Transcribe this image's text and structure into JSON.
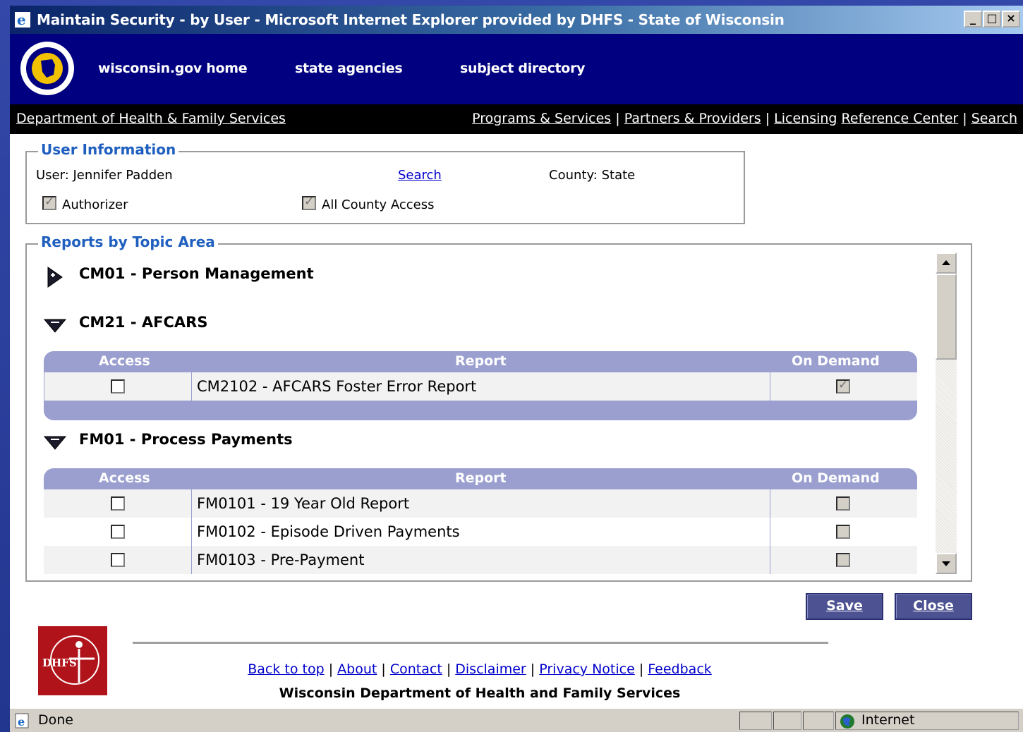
{
  "window": {
    "title": "Maintain Security - by User - Microsoft Internet Explorer provided by DHFS - State of Wisconsin",
    "controls": [
      "minimize",
      "maximize",
      "close"
    ]
  },
  "banner": {
    "links": [
      "wisconsin.gov home",
      "state agencies",
      "subject directory"
    ]
  },
  "dept_bar": {
    "name": "Department of Health & Family Services",
    "links": [
      "Programs & Services",
      "Partners & Providers",
      "Licensing",
      "Reference Center",
      "Search"
    ]
  },
  "user_info": {
    "legend": "User Information",
    "user_text": "User: Jennifer   Padden",
    "search_link": "Search",
    "county_text": "County: State",
    "authorizer_label": "Authorizer",
    "authorizer_checked": true,
    "all_county_label": "All County Access",
    "all_county_checked": true
  },
  "reports": {
    "legend": "Reports by Topic Area",
    "column_headers": {
      "access": "Access",
      "report": "Report",
      "on_demand": "On Demand"
    },
    "topics": [
      {
        "code": "CM01",
        "name": "Person Management",
        "expanded": false
      },
      {
        "code": "CM21",
        "name": "AFCARS",
        "expanded": true,
        "rows": [
          {
            "report": "CM2102 - AFCARS Foster Error Report",
            "access": false,
            "on_demand": true
          }
        ]
      },
      {
        "code": "FM01",
        "name": "Process Payments",
        "expanded": true,
        "rows": [
          {
            "report": "FM0101 - 19 Year Old Report",
            "access": false,
            "on_demand": false
          },
          {
            "report": "FM0102 - Episode Driven Payments",
            "access": false,
            "on_demand": false
          },
          {
            "report": "FM0103 - Pre-Payment",
            "access": false,
            "on_demand": false
          }
        ]
      }
    ]
  },
  "buttons": {
    "save": "Save",
    "close": "Close"
  },
  "footer": {
    "logo_text": "DHFS",
    "links": [
      "Back to top",
      "About",
      "Contact",
      "Disclaimer",
      "Privacy Notice",
      "Feedback"
    ],
    "separator": "|",
    "org": "Wisconsin Department of Health and Family Services"
  },
  "status_bar": {
    "status": "Done",
    "zone": "Internet"
  },
  "colors": {
    "banner": "#000080",
    "grid_header": "#9a9fcf",
    "legend": "#1f5fbf",
    "button": "#4c5292"
  },
  "icons": [
    "ie-icon",
    "wisconsin-seal-icon",
    "collapsed-arrow-icon",
    "expanded-arrow-icon",
    "dhfs-logo",
    "globe-icon"
  ]
}
